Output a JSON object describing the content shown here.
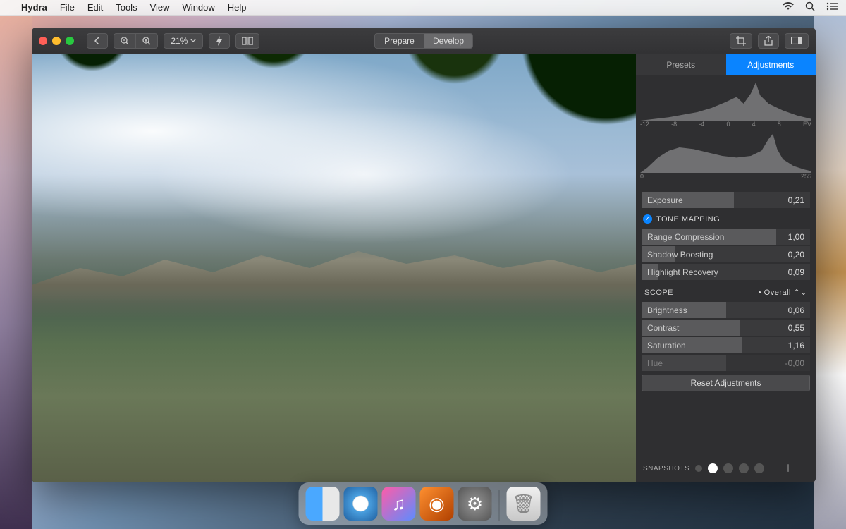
{
  "menubar": {
    "app_name": "Hydra",
    "items": [
      "File",
      "Edit",
      "Tools",
      "View",
      "Window",
      "Help"
    ]
  },
  "toolbar": {
    "zoom_label": "21%",
    "mode_prepare": "Prepare",
    "mode_develop": "Develop"
  },
  "sidebar": {
    "tabs": {
      "presets": "Presets",
      "adjustments": "Adjustments"
    },
    "ev_axis": [
      "-12",
      "-8",
      "-4",
      "0",
      "4",
      "8",
      "EV"
    ],
    "lum_axis": [
      "0",
      "255"
    ],
    "exposure": {
      "label": "Exposure",
      "value": "0,21",
      "fill": 55
    },
    "tone_mapping_title": "TONE MAPPING",
    "tone_mapping": [
      {
        "label": "Range Compression",
        "value": "1,00",
        "fill": 80
      },
      {
        "label": "Shadow Boosting",
        "value": "0,20",
        "fill": 20
      },
      {
        "label": "Highlight Recovery",
        "value": "0,09",
        "fill": 10
      }
    ],
    "scope": {
      "title": "SCOPE",
      "selected": "Overall"
    },
    "scope_sliders": [
      {
        "label": "Brightness",
        "value": "0,06",
        "fill": 50
      },
      {
        "label": "Contrast",
        "value": "0,55",
        "fill": 58
      },
      {
        "label": "Saturation",
        "value": "1,16",
        "fill": 60
      },
      {
        "label": "Hue",
        "value": "-0,00",
        "fill": 50
      }
    ],
    "reset": "Reset Adjustments",
    "snapshots_title": "SNAPSHOTS"
  },
  "dock": {
    "apps": [
      "Finder",
      "Safari",
      "Music",
      "Hydra",
      "System Settings"
    ],
    "trash": "Trash"
  }
}
